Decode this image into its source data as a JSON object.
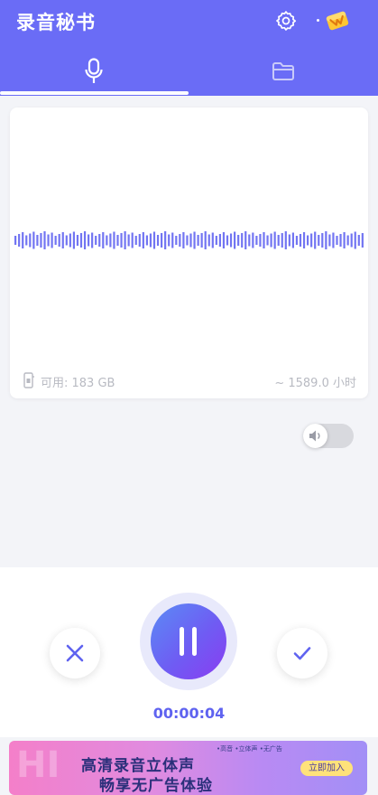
{
  "header": {
    "title": "录音秘书",
    "icons": [
      "gear-icon",
      "vip-crown-icon"
    ],
    "tabs": [
      {
        "name": "record",
        "icon": "microphone-icon",
        "active": true
      },
      {
        "name": "files",
        "icon": "folder-icon",
        "active": false
      }
    ]
  },
  "waveform": {
    "storage_label": "可用: 183 GB",
    "hours_label": "~ 1589.0 小时"
  },
  "speaker_toggle": {
    "icon": "speaker-icon",
    "on": false
  },
  "controls": {
    "cancel_icon": "close-icon",
    "pause_icon": "pause-icon",
    "confirm_icon": "checkmark-icon",
    "timer": "00:00:04"
  },
  "ad": {
    "line1": "高清录音立体声",
    "line2": "畅享无广告体验",
    "tags": "•高音 •立体声 •无广告",
    "cta": "立即加入"
  },
  "colors": {
    "primary": "#6a6cf6",
    "waveform": "#7275f2",
    "timer": "#5f63f0"
  }
}
